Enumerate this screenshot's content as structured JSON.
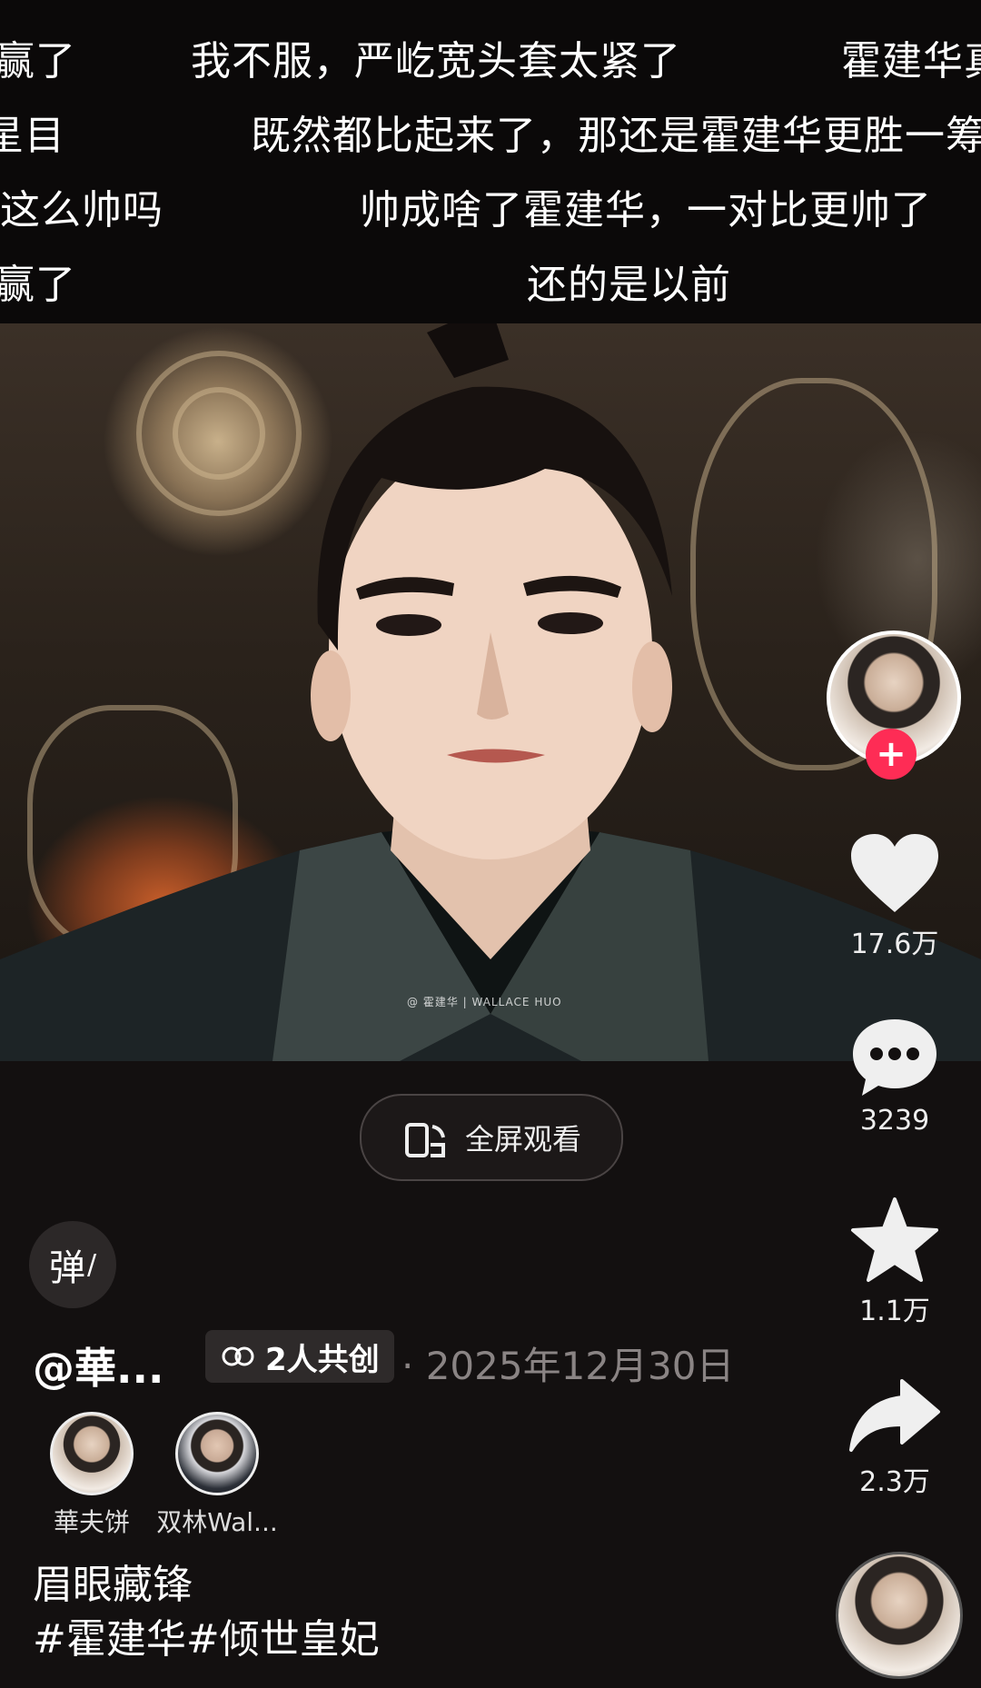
{
  "danmaku": [
    {
      "text": "赢了"
    },
    {
      "text": "我不服，严屹宽头套太紧了"
    },
    {
      "text": "霍建华真"
    },
    {
      "text": "星目"
    },
    {
      "text": "既然都比起来了，那还是霍建华更胜一筹"
    },
    {
      "text": "这么帅吗"
    },
    {
      "text": "帅成啥了霍建华，一对比更帅了"
    },
    {
      "text": "赢了"
    },
    {
      "text": "还的是以前"
    }
  ],
  "video": {
    "watermark": "@ 霍建华 | WALLACE HUO"
  },
  "fullscreen_button": {
    "label": "全屏观看",
    "icon": "rotate-phone-icon"
  },
  "rail": {
    "avatar_icon": "author-avatar",
    "follow_icon": "plus-icon",
    "like": {
      "icon": "heart-icon",
      "count": "17.6万"
    },
    "comment": {
      "icon": "comment-bubble-icon",
      "count": "3239"
    },
    "favorite": {
      "icon": "star-icon",
      "count": "1.1万"
    },
    "share": {
      "icon": "share-arrow-icon",
      "count": "2.3万"
    }
  },
  "info": {
    "danmu_toggle": "弹",
    "author": "@華...",
    "cocreate": "2人共创",
    "date": "· 2025年12月30日",
    "creators": [
      {
        "name": "華夫饼"
      },
      {
        "name": "双林Wal..."
      }
    ],
    "caption_line1": "眉眼藏锋",
    "caption_line2": "#霍建华#倾世皇妃"
  },
  "colors": {
    "background": "#131010",
    "accent": "#fe2c55",
    "muted_text": "#8a8484"
  }
}
